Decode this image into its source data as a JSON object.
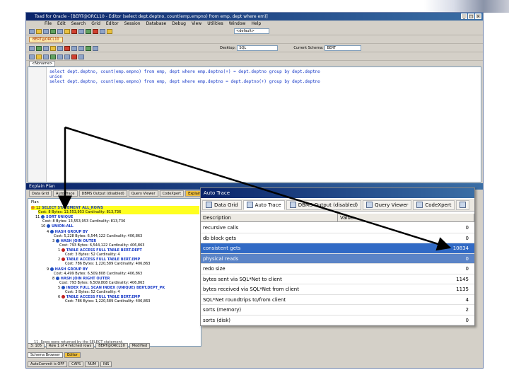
{
  "window": {
    "title": "Toad for Oracle - [BERT@ORCL10 - Editor (select dept.deptno, count(emp.empno) from emp, dept where em)]",
    "controls": [
      "_",
      "□",
      "×"
    ]
  },
  "menu": [
    "File",
    "Edit",
    "Search",
    "Grid",
    "Editor",
    "Session",
    "Database",
    "Debug",
    "View",
    "Utilities",
    "Window",
    "Help"
  ],
  "toolbar": {
    "connection": "BERT@ORCL10",
    "schema_combo": "<default>",
    "desktop_label": "Desktop:",
    "desktop_value": "SQL",
    "current_schema_label": "Current Schema:",
    "current_schema_value": "BERT"
  },
  "editor": {
    "tab": "<Noname>",
    "lines": [
      "select dept.deptno, count(emp.empno) from emp, dept where emp.deptno(+) = dept.deptno group by dept.deptno",
      "union",
      "select dept.deptno, count(emp.empno) from emp, dept where emp.deptno = dept.deptno(+) group by dept.deptno"
    ]
  },
  "explain": {
    "header": "Explain Plan",
    "tabs": [
      "Data Grid",
      "Auto Trace",
      "DBMS Output (disabled)",
      "Query Viewer",
      "CodeXpert",
      "Explain Plan"
    ],
    "plan_label": "Plan",
    "plan_lines": [
      {
        "id": "12",
        "node": "SELECT STATEMENT ALL_ROWS",
        "stats": "Cost: 8  Bytes: 13,553,953  Cardinality: 813,736"
      },
      {
        "id": "11",
        "node": "SORT UNIQUE",
        "stats": "Cost: 8  Bytes: 13,553,953  Cardinality: 813,736"
      },
      {
        "id": "10",
        "node": "UNION-ALL",
        "stats": "Cost: 9,827  Bytes: 13,553,953  Cardinality: 813,726"
      },
      {
        "id": "4",
        "node": "HASH GROUP BY",
        "stats": "Cost: 5,228  Bytes: 6,544,122  Cardinality: 406,863"
      },
      {
        "id": "3",
        "node": "HASH JOIN OUTER",
        "stats": "Cost: 793  Bytes: 6,544,122  Cardinality: 406,863"
      },
      {
        "id": "1",
        "node": "TABLE ACCESS FULL TABLE BERT.DEPT",
        "stats": "Cost: 3  Bytes: 52  Cardinality: 4"
      },
      {
        "id": "2",
        "node": "TABLE ACCESS FULL TABLE BERT.EMP",
        "stats": "Cost: 786  Bytes: 1,220,589  Cardinality: 406,863"
      },
      {
        "id": "9",
        "node": "HASH GROUP BY",
        "stats": "Cost: 4,499  Bytes: 6,509,808  Cardinality: 406,863"
      },
      {
        "id": "8",
        "node": "HASH JOIN RIGHT OUTER",
        "stats": "Cost: 793  Bytes: 6,509,808  Cardinality: 406,863"
      },
      {
        "id": "5",
        "node": "INDEX FULL SCAN INDEX (UNIQUE) BERT.DEPT_PK",
        "stats": "Cost: 3  Bytes: 52  Cardinality: 4"
      },
      {
        "id": "6",
        "node": "TABLE ACCESS FULL TABLE BERT.EMP",
        "stats": "Cost: 786  Bytes: 1,220,589  Cardinality: 406,863"
      }
    ],
    "footer_msg": "11. Rows were returned by the SELECT statement."
  },
  "status_top": [
    "3: 105",
    "Row 1 of 4 fetched rows",
    "BERT@ORCL10",
    "Modified"
  ],
  "taskbar": [
    "Schema Browser",
    "Editor"
  ],
  "status_bottom": [
    "AutoCommit is OFF",
    "CAPS",
    "NUM",
    "INS"
  ],
  "auto_trace": {
    "title": "Auto Trace",
    "tabs": [
      "Data Grid",
      "Auto Trace",
      "DBMS Output (disabled)",
      "Query Viewer",
      "CodeXpert"
    ],
    "columns": [
      "Description",
      "Value"
    ],
    "rows": [
      {
        "desc": "recursive calls",
        "value": "0"
      },
      {
        "desc": "db block gets",
        "value": "0"
      },
      {
        "desc": "consistent gets",
        "value": "10834"
      },
      {
        "desc": "physical reads",
        "value": "0"
      },
      {
        "desc": "redo size",
        "value": "0"
      },
      {
        "desc": "bytes sent via SQL*Net to client",
        "value": "1145"
      },
      {
        "desc": "bytes received via SQL*Net from client",
        "value": "1135"
      },
      {
        "desc": "SQL*Net roundtrips to/from client",
        "value": "4"
      },
      {
        "desc": "sorts (memory)",
        "value": "2"
      },
      {
        "desc": "sorts (disk)",
        "value": "0"
      }
    ]
  }
}
